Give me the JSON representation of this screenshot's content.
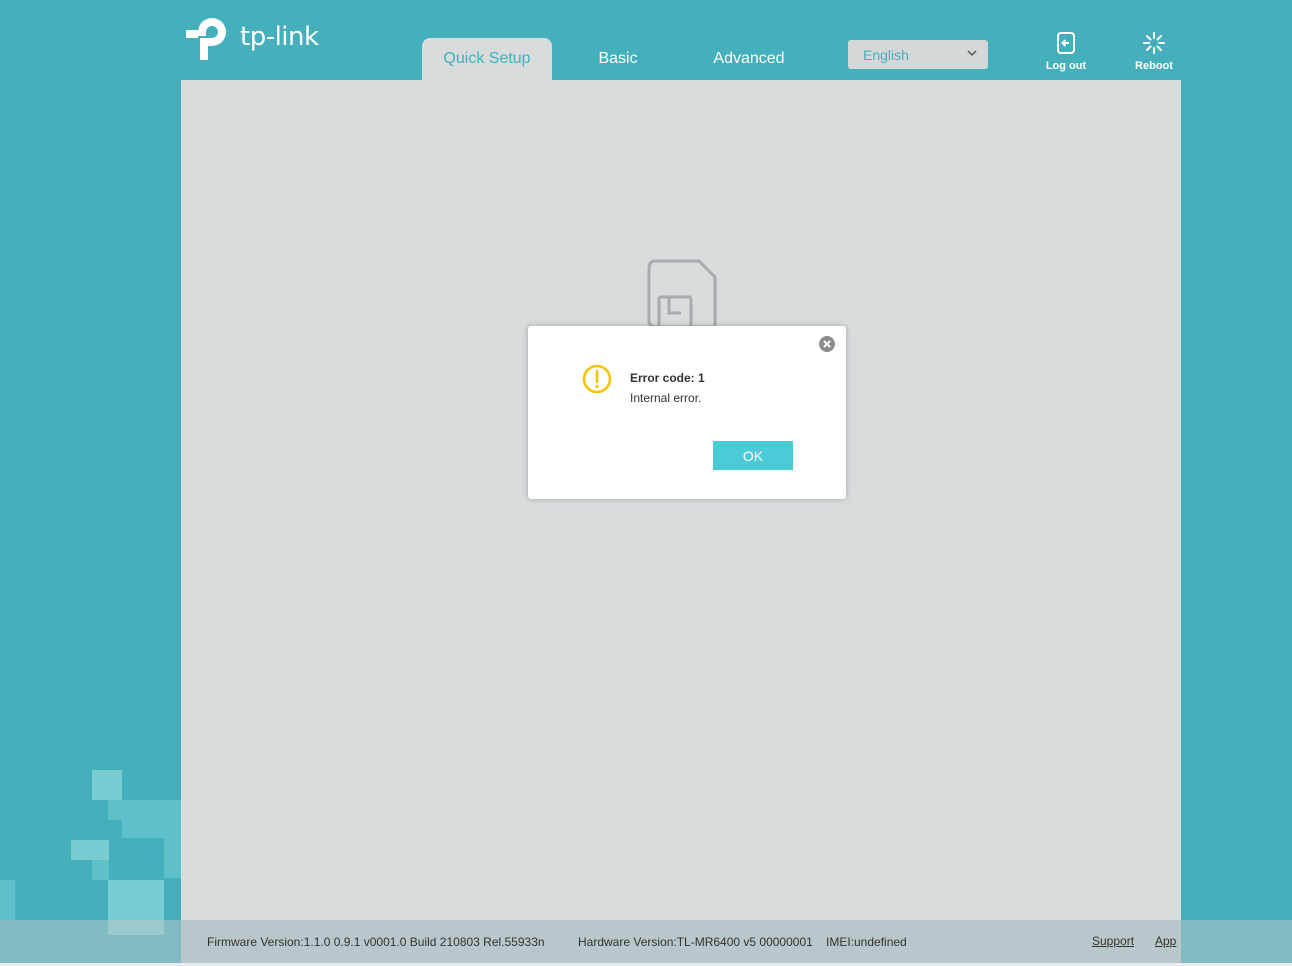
{
  "brand": {
    "logo_text": "tp-link"
  },
  "nav": {
    "tabs": [
      {
        "label": "Quick Setup",
        "active": true
      },
      {
        "label": "Basic",
        "active": false
      },
      {
        "label": "Advanced",
        "active": false
      }
    ]
  },
  "language": {
    "selected": "English"
  },
  "header_actions": {
    "logout_label": "Log out",
    "reboot_label": "Reboot"
  },
  "dialog": {
    "title": "Error code: 1",
    "message": "Internal error.",
    "ok_label": "OK",
    "icon": "warning-icon"
  },
  "footer": {
    "firmware": "Firmware Version:1.1.0 0.9.1 v0001.0 Build 210803 Rel.55933n",
    "hardware": "Hardware Version:TL-MR6400 v5 00000001",
    "imei": "IMEI:undefined",
    "support_label": "Support",
    "app_label": "App"
  },
  "colors": {
    "accent": "#45b0bb",
    "button": "#4acbd6",
    "warning": "#f5c400",
    "panel": "#d8dcdd"
  }
}
